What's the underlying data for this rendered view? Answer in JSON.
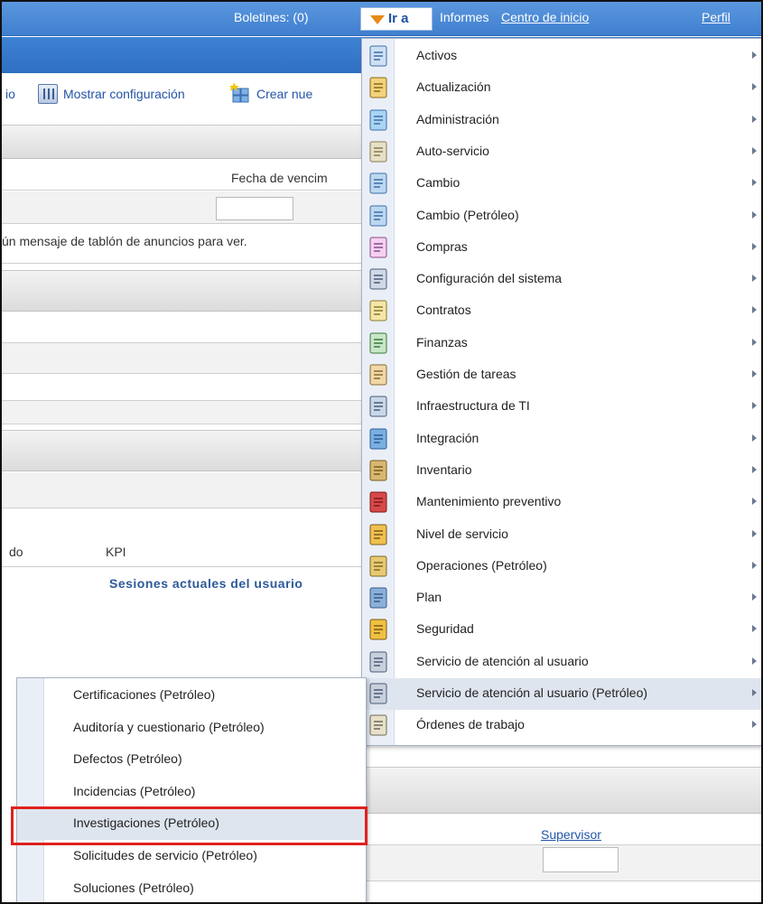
{
  "header": {
    "boletines": "Boletines: (0)",
    "goto_label": "Ir a",
    "informes": "Informes",
    "centro_inicio": "Centro de inicio",
    "perfil": "Perfil"
  },
  "toolbar": {
    "partial_left": "io",
    "show_config": "Mostrar configuración",
    "create_new": "Crear nue"
  },
  "background": {
    "fecha_header": "Fecha de vencim",
    "message": "ún mensaje de tablón de anuncios para ver.",
    "col_partial": "do",
    "col_kpi": "KPI",
    "sesiones": "Sesiones actuales del usuario",
    "supervisor": "Supervisor"
  },
  "goto_menu": {
    "items": [
      {
        "label": "Activos",
        "icon": "assets-icon"
      },
      {
        "label": "Actualización",
        "icon": "update-icon"
      },
      {
        "label": "Administración",
        "icon": "admin-icon"
      },
      {
        "label": "Auto-servicio",
        "icon": "self-service-icon"
      },
      {
        "label": "Cambio",
        "icon": "change-icon"
      },
      {
        "label": "Cambio (Petróleo)",
        "icon": "change-oil-icon"
      },
      {
        "label": "Compras",
        "icon": "purchasing-icon"
      },
      {
        "label": "Configuración del sistema",
        "icon": "system-config-icon"
      },
      {
        "label": "Contratos",
        "icon": "contracts-icon"
      },
      {
        "label": "Finanzas",
        "icon": "finance-icon"
      },
      {
        "label": "Gestión de tareas",
        "icon": "task-management-icon"
      },
      {
        "label": "Infraestructura de TI",
        "icon": "it-infrastructure-icon"
      },
      {
        "label": "Integración",
        "icon": "integration-icon"
      },
      {
        "label": "Inventario",
        "icon": "inventory-icon"
      },
      {
        "label": "Mantenimiento preventivo",
        "icon": "preventive-maintenance-icon"
      },
      {
        "label": "Nivel de servicio",
        "icon": "service-level-icon"
      },
      {
        "label": "Operaciones (Petróleo)",
        "icon": "operations-icon"
      },
      {
        "label": "Plan",
        "icon": "plan-icon"
      },
      {
        "label": "Seguridad",
        "icon": "security-icon"
      },
      {
        "label": "Servicio de atención al usuario",
        "icon": "service-desk-icon"
      },
      {
        "label": "Servicio de atención al usuario (Petróleo)",
        "icon": "service-desk-oil-icon"
      },
      {
        "label": "Órdenes de trabajo",
        "icon": "work-orders-icon"
      }
    ]
  },
  "submenu": {
    "items": [
      {
        "label": "Certificaciones (Petróleo)"
      },
      {
        "label": "Auditoría y cuestionario (Petróleo)"
      },
      {
        "label": "Defectos (Petróleo)"
      },
      {
        "label": "Incidencias (Petróleo)"
      },
      {
        "label": "Investigaciones (Petróleo)"
      },
      {
        "label": "Solicitudes de servicio (Petróleo)"
      },
      {
        "label": "Soluciones (Petróleo)"
      }
    ]
  },
  "colors": {
    "header_blue": "#4a8ad8",
    "menu_highlight": "#dfe5ef",
    "highlight_border": "#e0211d",
    "goto_arrow": "#e58a1b"
  }
}
